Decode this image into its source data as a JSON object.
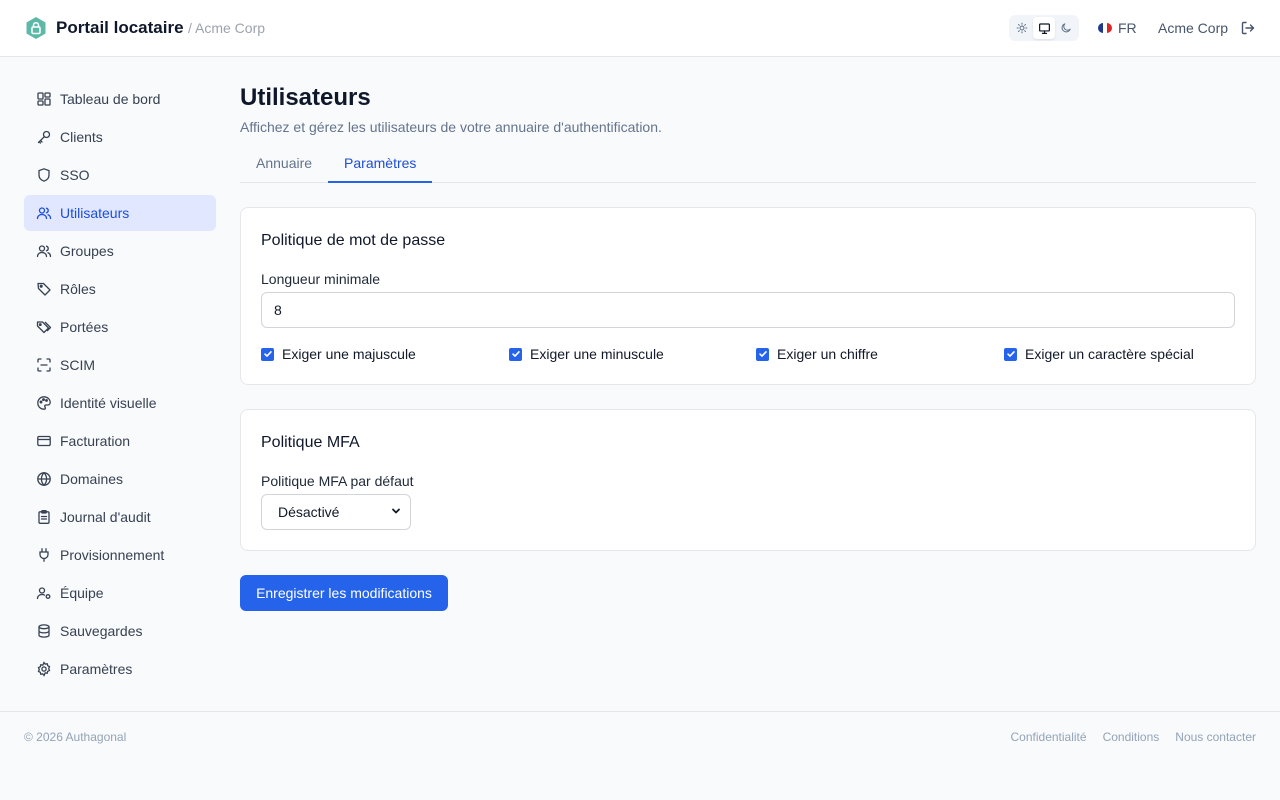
{
  "header": {
    "title": "Portail locataire",
    "org_path": "/ Acme Corp",
    "language": "FR",
    "org_menu": "Acme Corp",
    "theme_options": [
      "light",
      "system",
      "dark"
    ],
    "theme_selected": "system"
  },
  "sidebar": {
    "items": [
      {
        "label": "Tableau de bord",
        "icon": "dashboard-icon"
      },
      {
        "label": "Clients",
        "icon": "key-icon"
      },
      {
        "label": "SSO",
        "icon": "shield-icon"
      },
      {
        "label": "Utilisateurs",
        "icon": "users-icon",
        "active": true
      },
      {
        "label": "Groupes",
        "icon": "group-icon"
      },
      {
        "label": "Rôles",
        "icon": "tag-icon"
      },
      {
        "label": "Portées",
        "icon": "tags-icon"
      },
      {
        "label": "SCIM",
        "icon": "scan-icon"
      },
      {
        "label": "Identité visuelle",
        "icon": "palette-icon"
      },
      {
        "label": "Facturation",
        "icon": "credit-card-icon"
      },
      {
        "label": "Domaines",
        "icon": "globe-icon"
      },
      {
        "label": "Journal d'audit",
        "icon": "clipboard-icon"
      },
      {
        "label": "Provisionnement",
        "icon": "plug-icon"
      },
      {
        "label": "Équipe",
        "icon": "user-cog-icon"
      },
      {
        "label": "Sauvegardes",
        "icon": "database-icon"
      },
      {
        "label": "Paramètres",
        "icon": "gear-icon"
      }
    ]
  },
  "main": {
    "title": "Utilisateurs",
    "subtitle": "Affichez et gérez les utilisateurs de votre annuaire d'authentification.",
    "tabs": [
      {
        "label": "Annuaire",
        "active": false
      },
      {
        "label": "Paramètres",
        "active": true
      }
    ],
    "password_policy": {
      "title": "Politique de mot de passe",
      "min_length_label": "Longueur minimale",
      "min_length_value": "8",
      "checks": [
        {
          "label": "Exiger une majuscule",
          "checked": true
        },
        {
          "label": "Exiger une minuscule",
          "checked": true
        },
        {
          "label": "Exiger un chiffre",
          "checked": true
        },
        {
          "label": "Exiger un caractère spécial",
          "checked": true
        }
      ]
    },
    "mfa_policy": {
      "title": "Politique MFA",
      "default_label": "Politique MFA par défaut",
      "default_value": "Désactivé"
    },
    "save_label": "Enregistrer les modifications"
  },
  "footer": {
    "copyright": "© 2026 Authagonal",
    "links": [
      "Confidentialité",
      "Conditions",
      "Nous contacter"
    ]
  },
  "colors": {
    "accent": "#2563eb",
    "active_nav_bg": "#e0e7ff",
    "logo": "#5eb8a8"
  }
}
